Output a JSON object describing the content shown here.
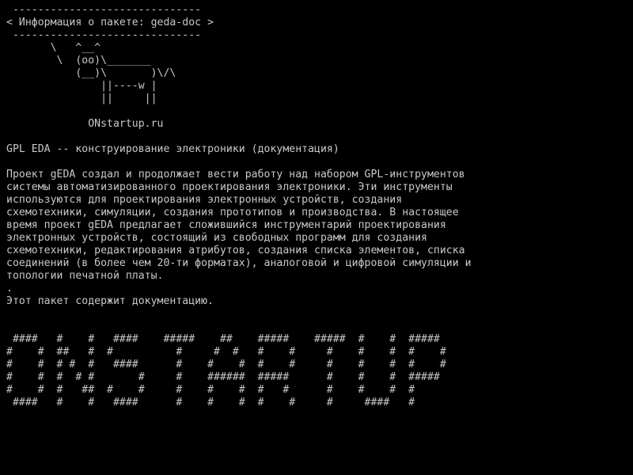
{
  "screen": {
    "background_color": "#000000",
    "text_color": "#c8c8c8"
  },
  "header": {
    "rule_top": " ------------------------------",
    "title_line": "< Информация о пакете: geda-doc >",
    "rule_bottom": " ------------------------------"
  },
  "cowsay_art": [
    "       \\   ^__^",
    "        \\  (oo)\\_______",
    "           (__)\\       )\\/\\",
    "               ||----w |",
    "               ||     ||"
  ],
  "site_label": "             ONstartup.ru",
  "package": {
    "summary": "GPL EDA -- конструирование электроники (документация)",
    "description_lines": [
      "Проект gEDA создал и продолжает вести работу над набором GPL-инструментов",
      "системы автоматизированного проектирования электроники. Эти инструменты",
      "используются для проектирования электронных устройств, создания",
      "схемотехники, симуляции, создания прототипов и производства. В настоящее",
      "время проект gEDA предлагает сложившийся инструментарий проектирования",
      "электронных устройств, состоящий из свободных программ для создания",
      "схемотехники, редактирования атрибутов, создания списка элементов, списка",
      "соединений (в более чем 20-ти форматах), аналоговой и цифровой симуляции и",
      "топологии печатной платы."
    ],
    "separator": ".",
    "note": "Этот пакет содержит документацию."
  },
  "banner_lines": [
    " ####   #    #   ####    #####    ##    #####    #####  #    #  #####",
    "#    #  ##   #  #          #     #  #   #    #     #    #    #  #    #",
    "#    #  # #  #   ####      #    #    #  #    #     #    #    #  #    #",
    "#    #  #  # #       #     #    ######  #####      #    #    #  #####",
    "#    #  #   ##  #    #     #    #    #  #   #      #    #    #  #",
    " ####   #    #   ####      #    #    #  #    #     #     ####   #"
  ]
}
